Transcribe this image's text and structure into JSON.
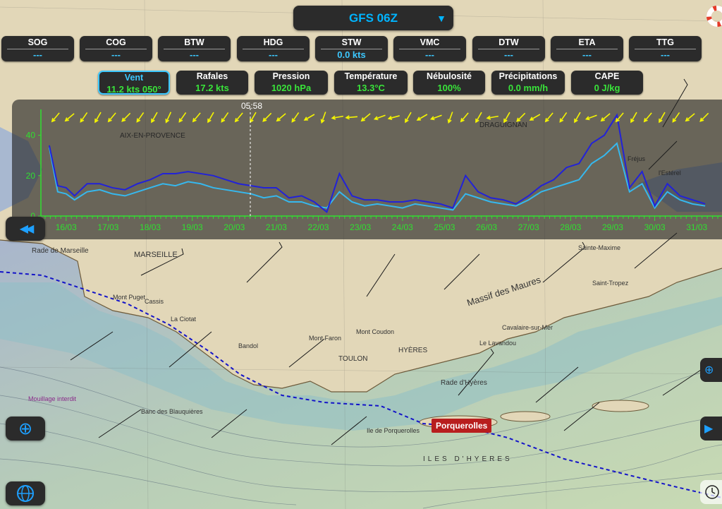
{
  "model_selector": {
    "label": "GFS 06Z",
    "caret": "▼"
  },
  "nav_instruments": [
    {
      "label": "SOG",
      "value": "---"
    },
    {
      "label": "COG",
      "value": "---"
    },
    {
      "label": "BTW",
      "value": "---"
    },
    {
      "label": "HDG",
      "value": "---"
    },
    {
      "label": "STW",
      "value": "0.0 kts"
    },
    {
      "label": "VMC",
      "value": "---"
    },
    {
      "label": "DTW",
      "value": "---"
    },
    {
      "label": "ETA",
      "value": "---"
    },
    {
      "label": "TTG",
      "value": "---"
    }
  ],
  "weather_params": [
    {
      "label": "Vent",
      "value": "11.2 kts 050°",
      "active": true
    },
    {
      "label": "Rafales",
      "value": "17.2 kts"
    },
    {
      "label": "Pression",
      "value": "1020 hPa"
    },
    {
      "label": "Température",
      "value": "13.3°C"
    },
    {
      "label": "Nébulosité",
      "value": "100%"
    },
    {
      "label": "Précipitations",
      "value": "0.0 mm/h"
    },
    {
      "label": "CAPE",
      "value": "0 J/kg"
    }
  ],
  "graph": {
    "cursor_time": "05:58",
    "y_ticks": [
      "0",
      "20",
      "40"
    ],
    "x_ticks": [
      "16/03",
      "17/03",
      "18/03",
      "19/03",
      "20/03",
      "21/03",
      "22/03",
      "23/03",
      "24/03",
      "25/03",
      "26/03",
      "27/03",
      "28/03",
      "29/03",
      "30/03",
      "31/03"
    ],
    "colors": {
      "wind": "#36b8ee",
      "gust": "#2222d8",
      "axis": "#30e030",
      "arrows": "#f5f500",
      "cursor": "#ffffff"
    }
  },
  "chart_data": {
    "type": "line",
    "ylim": [
      0,
      50
    ],
    "x_labels": [
      "16/03",
      "17/03",
      "18/03",
      "19/03",
      "20/03",
      "21/03",
      "22/03",
      "23/03",
      "24/03",
      "25/03",
      "26/03",
      "27/03",
      "28/03",
      "29/03",
      "30/03",
      "31/03"
    ],
    "series": [
      {
        "name": "Vent",
        "x": [
          15.6,
          15.8,
          16.0,
          16.2,
          16.5,
          16.8,
          17.1,
          17.4,
          17.7,
          18.0,
          18.3,
          18.6,
          18.9,
          19.2,
          19.5,
          19.8,
          20.1,
          20.4,
          20.7,
          21.0,
          21.3,
          21.6,
          21.9,
          22.2,
          22.5,
          22.8,
          23.1,
          23.4,
          23.7,
          24.0,
          24.3,
          24.6,
          24.9,
          25.2,
          25.5,
          25.8,
          26.1,
          26.4,
          26.7,
          27.0,
          27.3,
          27.6,
          27.9,
          28.2,
          28.5,
          28.8,
          29.1,
          29.4,
          29.7,
          30.0,
          30.3,
          30.6,
          30.9,
          31.2
        ],
        "y": [
          34,
          12,
          11,
          8,
          12,
          13,
          11,
          10,
          12,
          14,
          16,
          15,
          17,
          16,
          14,
          13,
          12,
          11,
          9,
          10,
          7,
          7,
          5,
          4,
          12,
          7,
          5,
          6,
          5,
          4,
          6,
          5,
          4,
          3,
          11,
          9,
          7,
          6,
          5,
          8,
          12,
          14,
          16,
          18,
          26,
          30,
          36,
          12,
          16,
          4,
          12,
          8,
          6,
          5
        ]
      },
      {
        "name": "Rafales",
        "x": [
          15.6,
          15.8,
          16.0,
          16.2,
          16.5,
          16.8,
          17.1,
          17.4,
          17.7,
          18.0,
          18.3,
          18.6,
          18.9,
          19.2,
          19.5,
          19.8,
          20.1,
          20.4,
          20.7,
          21.0,
          21.3,
          21.6,
          21.9,
          22.2,
          22.5,
          22.8,
          23.1,
          23.4,
          23.7,
          24.0,
          24.3,
          24.6,
          24.9,
          25.2,
          25.5,
          25.8,
          26.1,
          26.4,
          26.7,
          27.0,
          27.3,
          27.6,
          27.9,
          28.2,
          28.5,
          28.8,
          29.1,
          29.4,
          29.7,
          30.0,
          30.3,
          30.6,
          30.9,
          31.2
        ],
        "y": [
          35,
          15,
          14,
          10,
          16,
          16,
          14,
          13,
          16,
          18,
          21,
          21,
          22,
          21,
          20,
          18,
          16,
          15,
          14,
          14,
          9,
          10,
          7,
          2,
          21,
          10,
          8,
          8,
          7,
          7,
          8,
          7,
          6,
          4,
          20,
          12,
          9,
          8,
          6,
          10,
          15,
          18,
          24,
          26,
          36,
          40,
          50,
          14,
          22,
          5,
          16,
          10,
          8,
          6
        ]
      }
    ]
  },
  "buttons": {
    "rewind": "◀◀",
    "locate": "⊕",
    "play": "▶"
  },
  "map_labels": {
    "marseille": "MARSEILLE",
    "rade": "Rade de Marseille",
    "aix": "AIX-EN-PROVENCE",
    "toulon": "TOULON",
    "hyeres": "HYÈRES",
    "draguignan": "DRAGUIGNAN",
    "porquerolles": "Porquerolles",
    "ile_porquerolles": "Ile de Porquerolles",
    "la_ciotat": "La Ciotat",
    "cassis": "Cassis",
    "bandol": "Bandol",
    "sainte_maxime": "Sainte-Maxime",
    "saint_tropez": "Saint-Tropez",
    "frejus": "Fréjus",
    "esterel": "l'Estérel",
    "iles_hyeres": "ILES D'HYERES",
    "cavalaire": "Cavalaire-sur-Mer",
    "le_lavandou": "Le Lavandou",
    "mouillage": "Mouillage interdit",
    "blauquieres": "Banc des Blauquières",
    "massif": "Massif des Maures",
    "rade_hyeres": "Rade d'Hyères",
    "mont_puget": "Mont Puget",
    "mont_coudon": "Mont Coudon",
    "mont_faron": "Mont Faron"
  }
}
